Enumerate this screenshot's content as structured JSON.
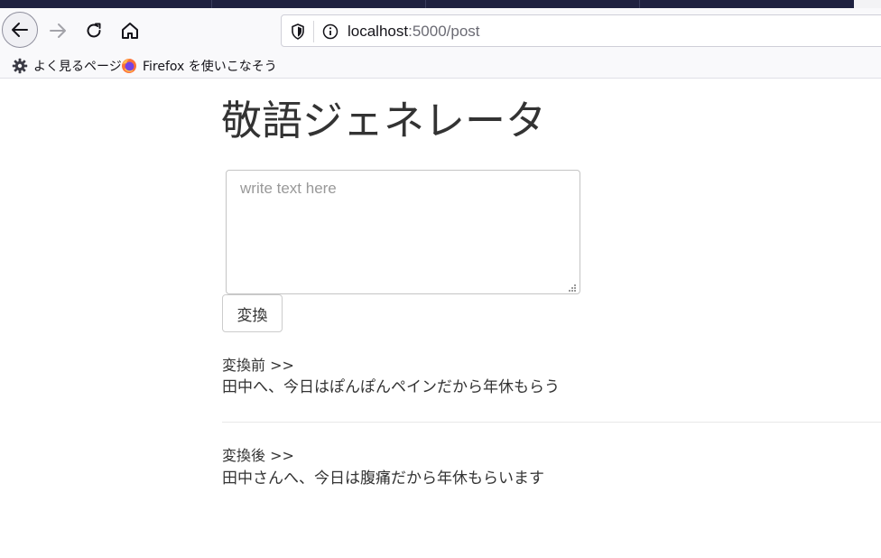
{
  "browser": {
    "url_host": "localhost",
    "url_rest": ":5000/post",
    "bookmarks": [
      {
        "label": "よく見るページ",
        "icon": "gear-icon"
      },
      {
        "label": "Firefox を使いこなそう",
        "icon": "firefox-icon"
      }
    ],
    "colors": {
      "tabstrip": "#1f2140",
      "toolbar": "#f9f9fb"
    }
  },
  "page": {
    "title": "敬語ジェネレータ",
    "input_placeholder": "write text here",
    "convert_label": "変換",
    "before_label": "変換前 >>",
    "before_text": "田中へ、今日はぽんぽんペインだから年休もらう",
    "after_label": "変換後 >>",
    "after_text": "田中さんへ、今日は腹痛だから年休もらいます"
  }
}
